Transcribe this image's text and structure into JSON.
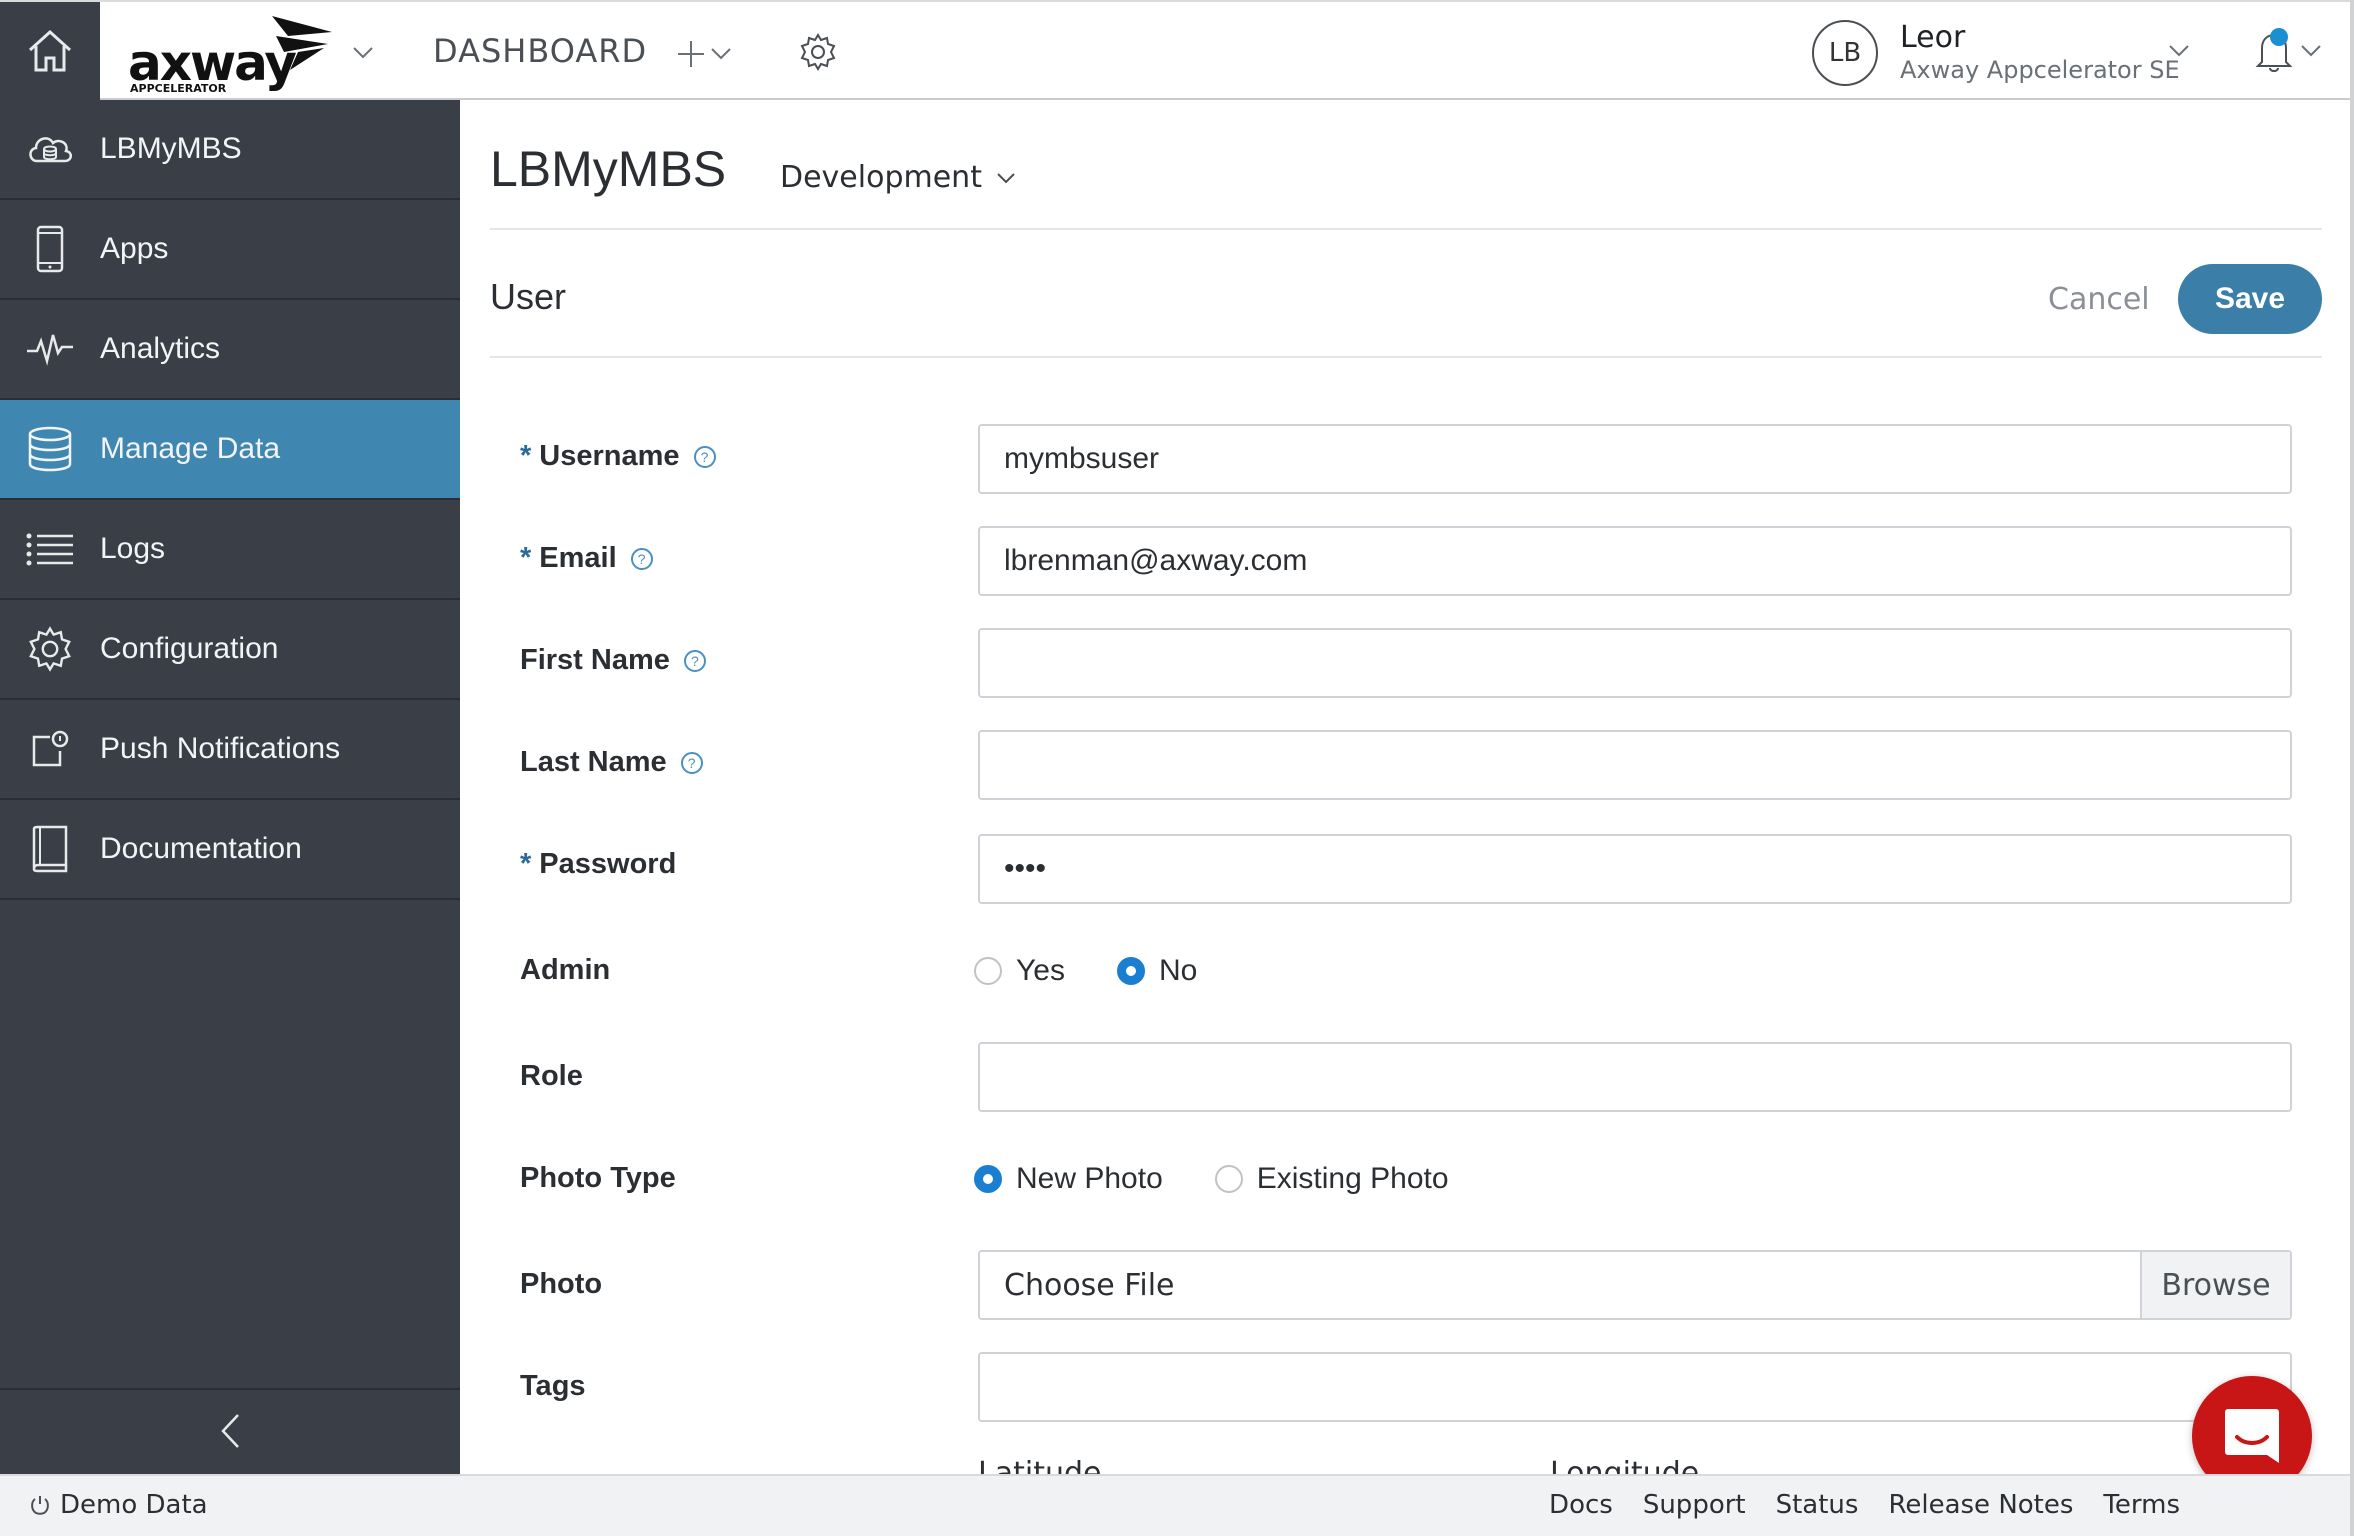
{
  "header": {
    "logo_text": "axway",
    "logo_subtext": "APPCELERATOR",
    "dashboard_label": "DASHBOARD",
    "user_initials": "LB",
    "user_name": "Leor",
    "user_org": "Axway Appcelerator SE"
  },
  "sidebar": {
    "items": [
      {
        "label": "LBMyMBS",
        "icon": "cloud-db-icon",
        "active": false
      },
      {
        "label": "Apps",
        "icon": "phone-icon",
        "active": false
      },
      {
        "label": "Analytics",
        "icon": "pulse-icon",
        "active": false
      },
      {
        "label": "Manage Data",
        "icon": "database-icon",
        "active": true
      },
      {
        "label": "Logs",
        "icon": "list-icon",
        "active": false
      },
      {
        "label": "Configuration",
        "icon": "gear-icon",
        "active": false
      },
      {
        "label": "Push Notifications",
        "icon": "push-notification-icon",
        "active": false
      },
      {
        "label": "Documentation",
        "icon": "book-icon",
        "active": false
      }
    ]
  },
  "main": {
    "app_title": "LBMyMBS",
    "environment": "Development",
    "section_title": "User",
    "cancel_label": "Cancel",
    "save_label": "Save"
  },
  "form": {
    "required_mark": "*",
    "username": {
      "label": "Username",
      "value": "mymbsuser"
    },
    "email": {
      "label": "Email",
      "value": "lbrenman@axway.com"
    },
    "first_name": {
      "label": "First Name",
      "value": ""
    },
    "last_name": {
      "label": "Last Name",
      "value": ""
    },
    "password": {
      "label": "Password",
      "value": "••••"
    },
    "admin": {
      "label": "Admin",
      "options": [
        "Yes",
        "No"
      ],
      "selected": "No"
    },
    "role": {
      "label": "Role",
      "value": ""
    },
    "photo_type": {
      "label": "Photo Type",
      "options": [
        "New Photo",
        "Existing Photo"
      ],
      "selected": "New Photo"
    },
    "photo": {
      "label": "Photo",
      "file_text": "Choose File",
      "browse_label": "Browse"
    },
    "tags": {
      "label": "Tags",
      "value": ""
    },
    "latitude_label": "Latitude",
    "longitude_label": "Longitude"
  },
  "footer": {
    "demo_label": "Demo Data",
    "links": [
      "Docs",
      "Support",
      "Status",
      "Release Notes",
      "Terms"
    ]
  },
  "colors": {
    "sidebar_bg": "#3a3f47",
    "active_item": "#3f87b1",
    "save_button": "#3b7fa8",
    "radio_selected": "#1b7fd1",
    "chat_button": "#c81515"
  }
}
